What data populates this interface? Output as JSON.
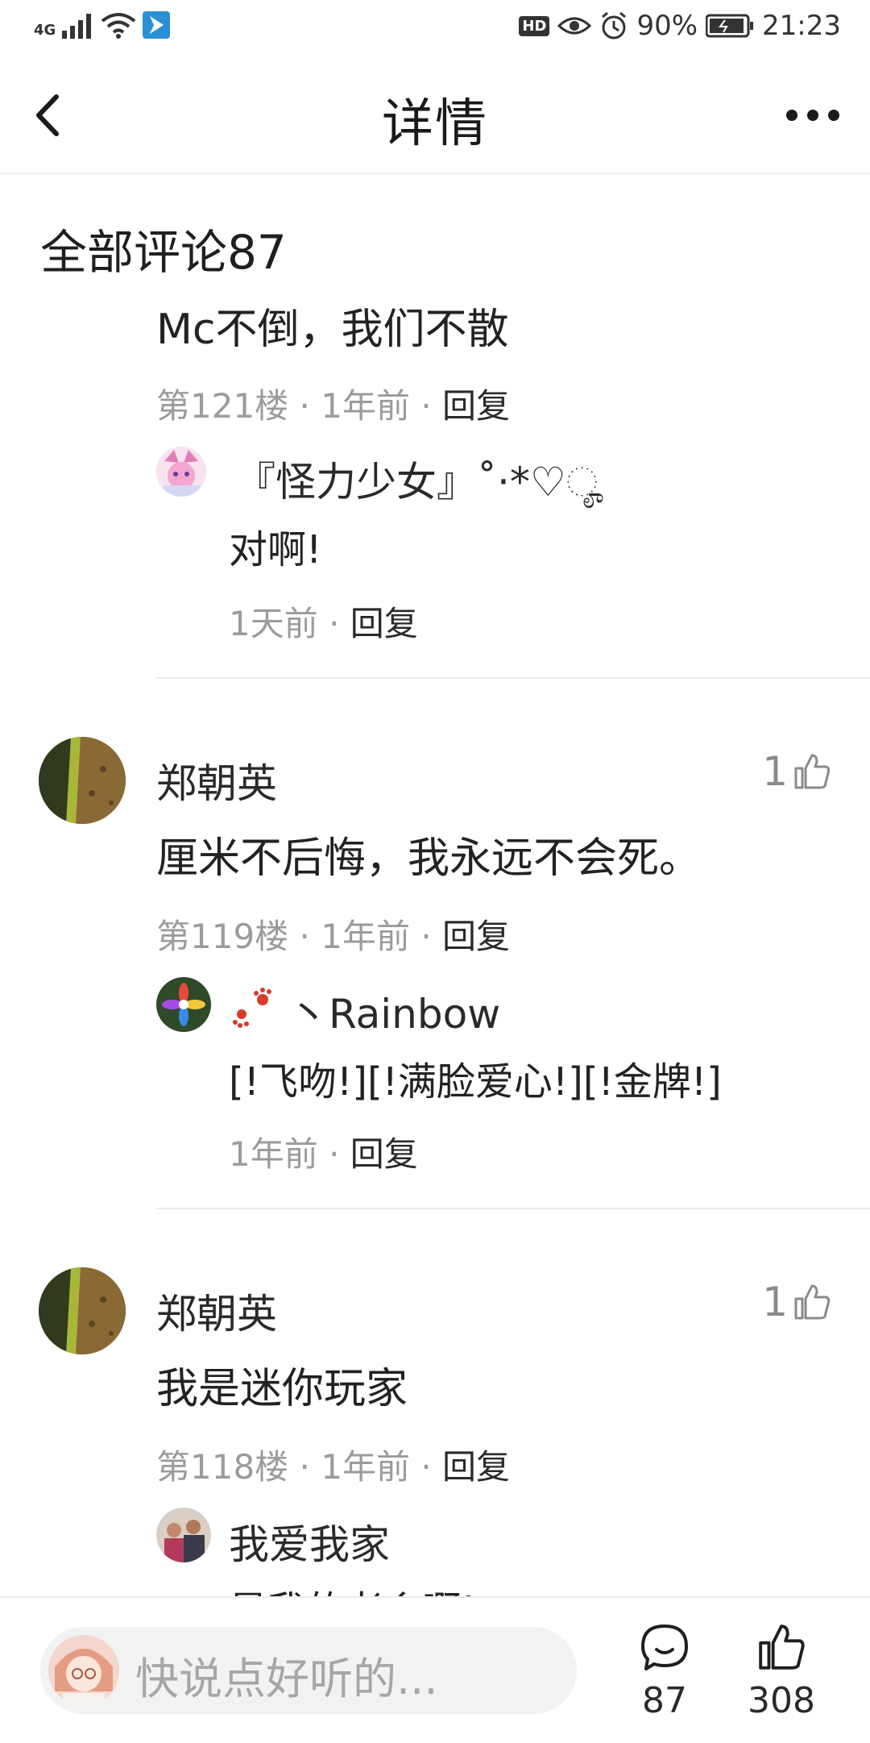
{
  "status_bar": {
    "network": "4G",
    "battery": "90%",
    "time": "21:23",
    "hd": "HD"
  },
  "nav": {
    "title": "详情"
  },
  "section": {
    "title": "全部评论87"
  },
  "comments": [
    {
      "text": "Mc不倒，我们不散",
      "floor": "第121楼",
      "time": "1年前",
      "reply_label": "回复",
      "reply": {
        "user": "『怪力少女』˚·*♡ೄ",
        "text": "对啊!",
        "time": "1天前",
        "reply_label": "回复"
      }
    },
    {
      "user": "郑朝英",
      "likes": "1",
      "text": "厘米不后悔，我永远不会死。",
      "floor": "第119楼",
      "time": "1年前",
      "reply_label": "回复",
      "reply": {
        "user": "丶Rainbow",
        "text": "[!飞吻!][!满脸爱心!][!金牌!]",
        "time": "1年前",
        "reply_label": "回复"
      }
    },
    {
      "user": "郑朝英",
      "likes": "1",
      "text": "我是迷你玩家",
      "floor": "第118楼",
      "time": "1年前",
      "reply_label": "回复",
      "reply": {
        "user": "我爱我家",
        "text": "是我的老乡啊!"
      }
    }
  ],
  "bottom": {
    "placeholder": "快说点好听的...",
    "comment_count": "87",
    "like_count": "308"
  },
  "colors": {
    "text": "#1f1f1f",
    "meta": "#9b9b9b",
    "divider": "#ececec",
    "pill": "#f2f2f2"
  }
}
